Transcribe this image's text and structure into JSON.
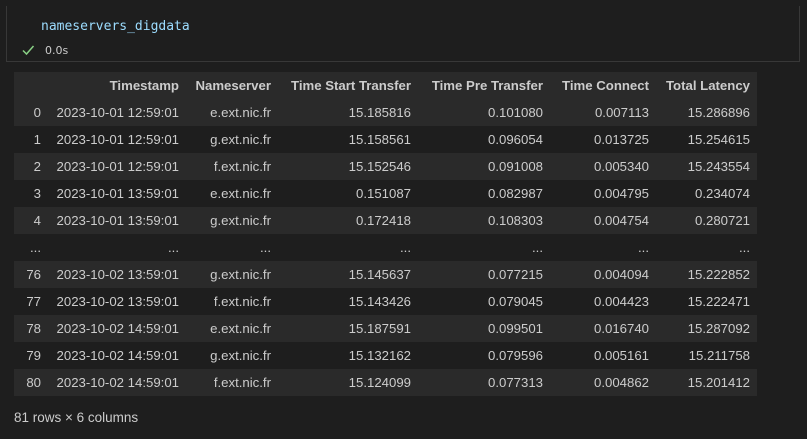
{
  "cell": {
    "code": "nameservers_digdata",
    "exec_time": "0.0s",
    "status_icon": "check-icon",
    "status_color": "#89d185"
  },
  "table": {
    "columns": [
      "",
      "Timestamp",
      "Nameserver",
      "Time Start Transfer",
      "Time Pre Transfer",
      "Time Connect",
      "Total Latency"
    ],
    "rows": [
      [
        "0",
        "2023-10-01 12:59:01",
        "e.ext.nic.fr",
        "15.185816",
        "0.101080",
        "0.007113",
        "15.286896"
      ],
      [
        "1",
        "2023-10-01 12:59:01",
        "g.ext.nic.fr",
        "15.158561",
        "0.096054",
        "0.013725",
        "15.254615"
      ],
      [
        "2",
        "2023-10-01 12:59:01",
        "f.ext.nic.fr",
        "15.152546",
        "0.091008",
        "0.005340",
        "15.243554"
      ],
      [
        "3",
        "2023-10-01 13:59:01",
        "e.ext.nic.fr",
        "0.151087",
        "0.082987",
        "0.004795",
        "0.234074"
      ],
      [
        "4",
        "2023-10-01 13:59:01",
        "g.ext.nic.fr",
        "0.172418",
        "0.108303",
        "0.004754",
        "0.280721"
      ],
      [
        "...",
        "...",
        "...",
        "...",
        "...",
        "...",
        "..."
      ],
      [
        "76",
        "2023-10-02 13:59:01",
        "g.ext.nic.fr",
        "15.145637",
        "0.077215",
        "0.004094",
        "15.222852"
      ],
      [
        "77",
        "2023-10-02 13:59:01",
        "f.ext.nic.fr",
        "15.143426",
        "0.079045",
        "0.004423",
        "15.222471"
      ],
      [
        "78",
        "2023-10-02 14:59:01",
        "e.ext.nic.fr",
        "15.187591",
        "0.099501",
        "0.016740",
        "15.287092"
      ],
      [
        "79",
        "2023-10-02 14:59:01",
        "g.ext.nic.fr",
        "15.132162",
        "0.079596",
        "0.005161",
        "15.211758"
      ],
      [
        "80",
        "2023-10-02 14:59:01",
        "f.ext.nic.fr",
        "15.124099",
        "0.077313",
        "0.004862",
        "15.201412"
      ]
    ]
  },
  "shape_info": "81 rows × 6 columns"
}
